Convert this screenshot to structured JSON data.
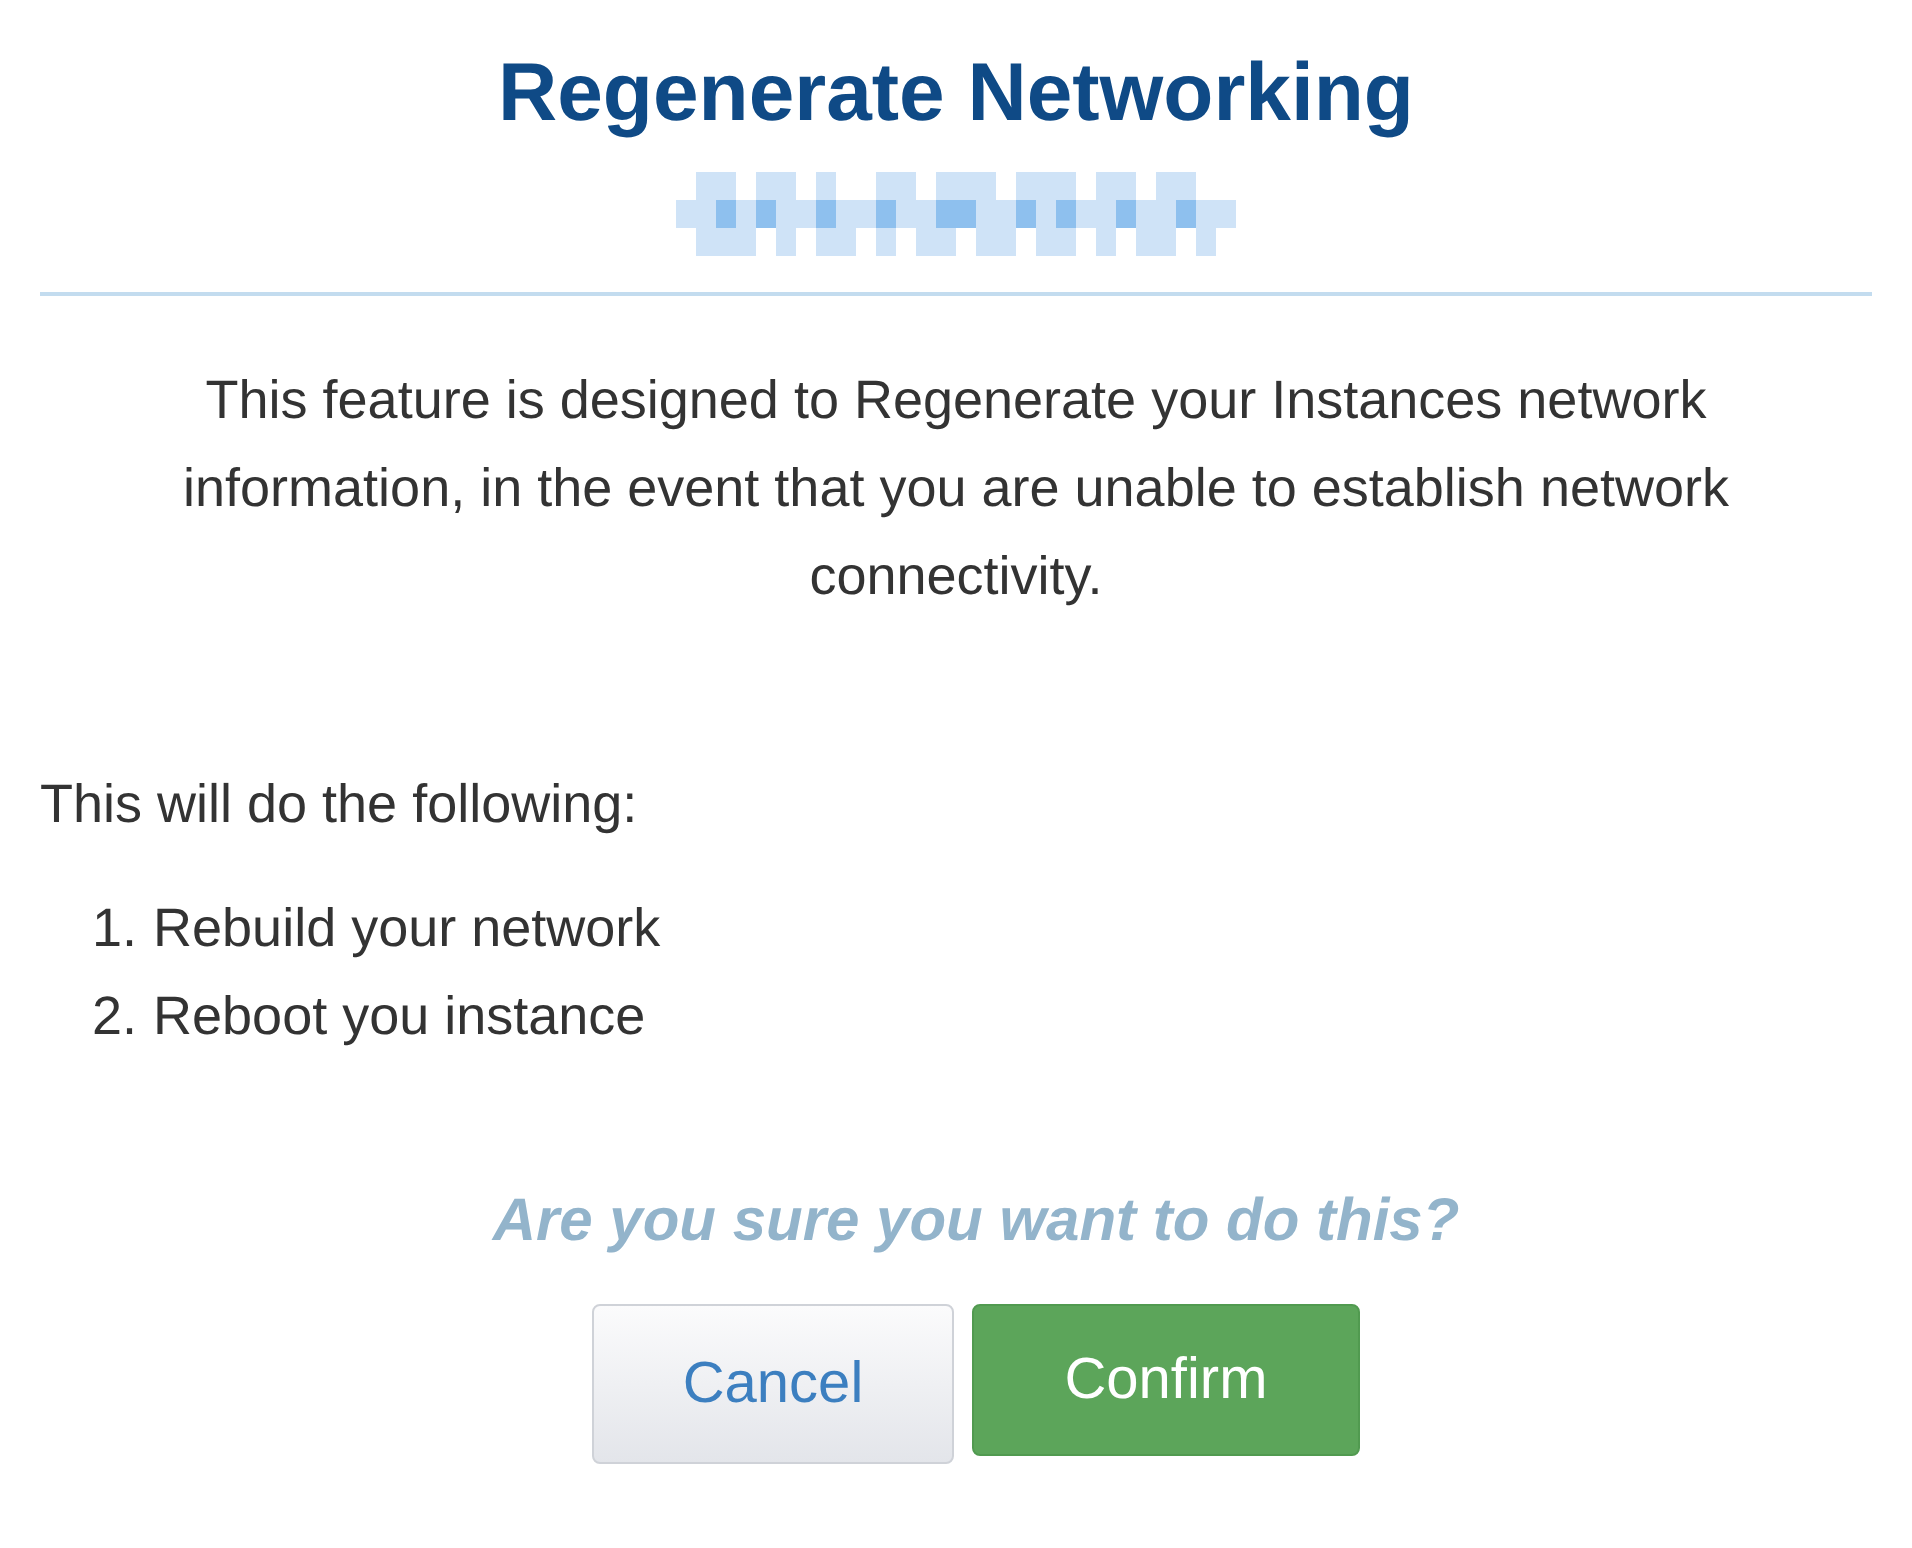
{
  "dialog": {
    "title": "Regenerate Networking",
    "description": "This feature is designed to Regenerate your Instances network information, in the event that you are unable to establish network connectivity.",
    "list_heading": "This will do the following:",
    "steps": [
      {
        "number": "1.",
        "text": "Rebuild your network"
      },
      {
        "number": "2.",
        "text": "Reboot you instance"
      }
    ],
    "question": "Are you sure you want to do this?",
    "buttons": [
      {
        "kind": "secondary",
        "label": "Cancel"
      },
      {
        "kind": "primary",
        "label": "Confirm"
      }
    ]
  }
}
